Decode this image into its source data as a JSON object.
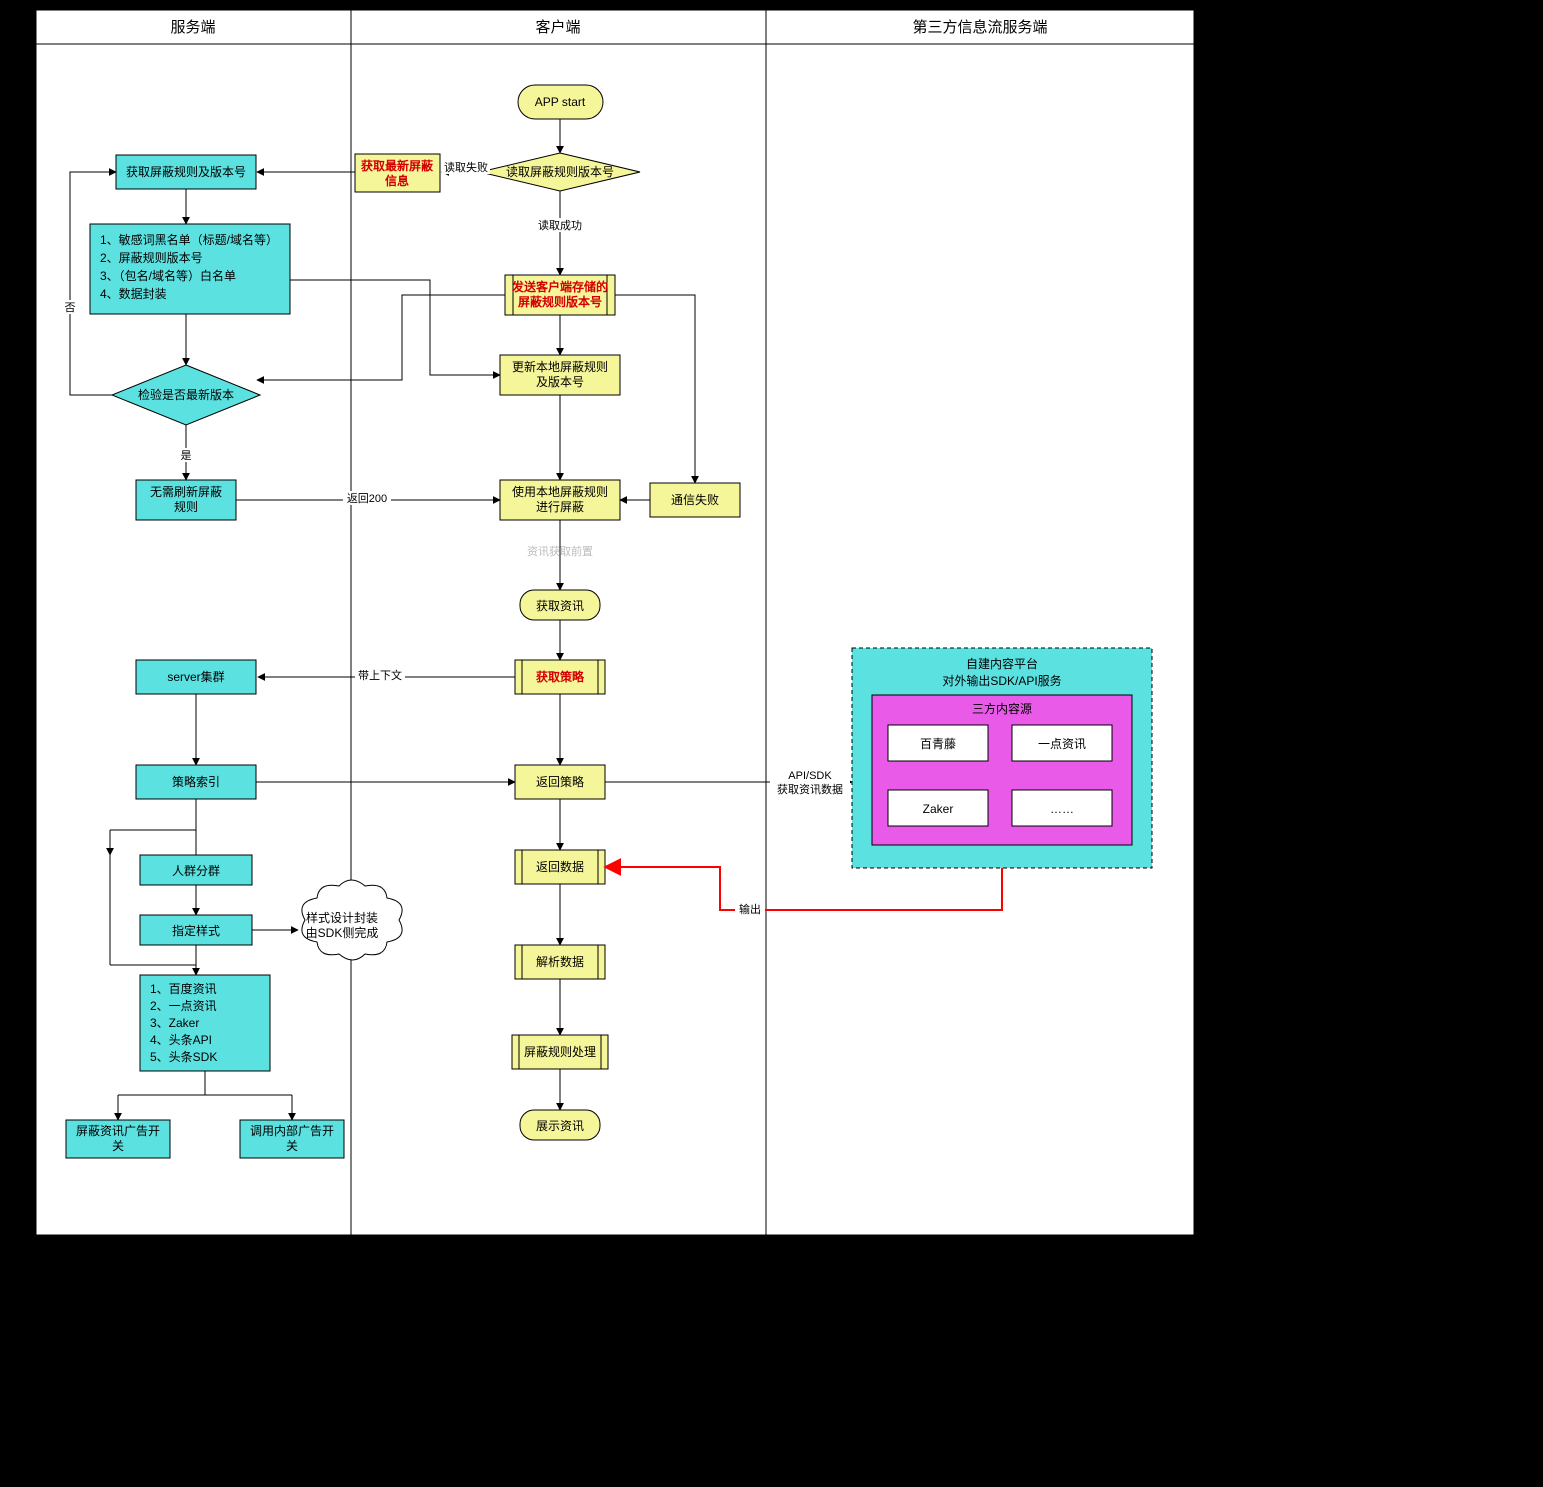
{
  "lanes": {
    "server": {
      "title": "服务端"
    },
    "client": {
      "title": "客户端"
    },
    "third": {
      "title": "第三方信息流服务端"
    }
  },
  "nodes": {
    "app_start": "APP start",
    "read_rule_ver": "读取屏蔽规则版本号",
    "get_latest_block": [
      "获取最新屏蔽",
      "信息"
    ],
    "get_rules_ver": "获取屏蔽规则及版本号",
    "rule_package": [
      "1、敏感词黑名单（标题/域名等）",
      "2、屏蔽规则版本号",
      "3、（包名/域名等）白名单",
      "4、数据封装"
    ],
    "check_latest": "检验是否最新版本",
    "no_refresh": [
      "无需刷新屏蔽",
      "规则"
    ],
    "send_client_ver": [
      "发送客户端存储的",
      "屏蔽规则版本号"
    ],
    "update_local": [
      "更新本地屏蔽规则",
      "及版本号"
    ],
    "comm_fail": "通信失败",
    "use_local_rules": [
      "使用本地屏蔽规则",
      "进行屏蔽"
    ],
    "fetch_news": "获取资讯",
    "fetch_policy": "获取策略",
    "server_cluster": "server集群",
    "policy_index": "策略索引",
    "crowd_group": "人群分群",
    "style_spec": "指定样式",
    "style_sdk_cloud": [
      "样式设计封装",
      "由SDK侧完成"
    ],
    "news_sources": [
      "1、百度资讯",
      "2、一点资讯",
      "3、Zaker",
      "4、头条API",
      "5、头条SDK"
    ],
    "block_news_ad": [
      "屏蔽资讯广告开",
      "关"
    ],
    "call_internal_ad": [
      "调用内部广告开",
      "关"
    ],
    "return_policy": "返回策略",
    "return_data": "返回数据",
    "parse_data": "解析数据",
    "rule_process": "屏蔽规则处理",
    "display_news": "展示资讯",
    "self_platform": [
      "自建内容平台",
      "对外输出SDK/API服务"
    ],
    "third_sources": "三方内容源",
    "src_bqt": "百青藤",
    "src_ydzx": "一点资讯",
    "src_zaker": "Zaker",
    "src_more": "……"
  },
  "edges": {
    "read_fail": "读取失败",
    "read_ok": "读取成功",
    "branch_no": "否",
    "branch_yes": "是",
    "return200": "返回200",
    "with_ctx": "带上下文",
    "api_sdk": [
      "API/SDK",
      "获取资讯数据"
    ],
    "output": "输出",
    "pre_fetch": "资讯获取前置"
  }
}
